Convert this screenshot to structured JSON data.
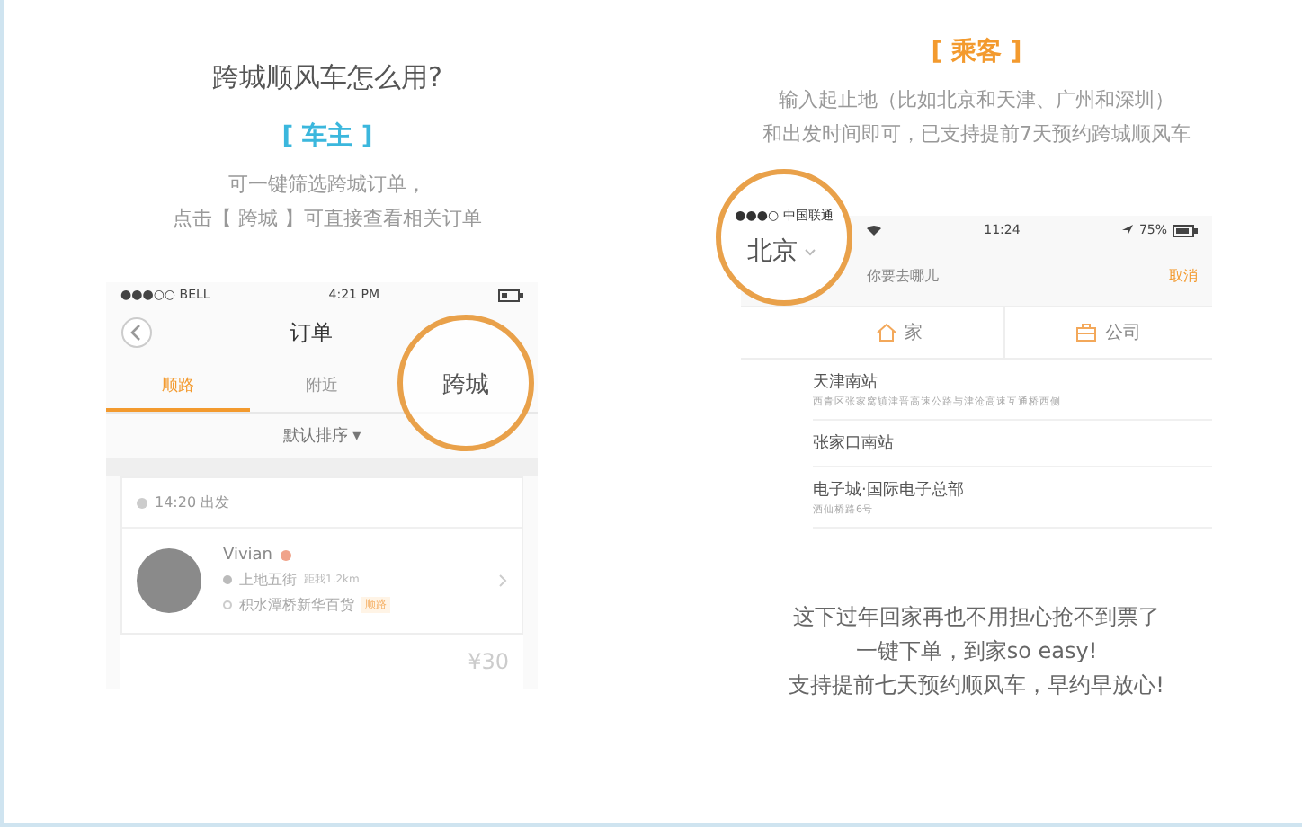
{
  "title": "跨城顺风车怎么用?",
  "driver": {
    "heading": "[ 车主 ]",
    "description": [
      "可一键筛选跨城订单，",
      "点击【 跨城 】可直接查看相关订单"
    ],
    "phone": {
      "carrier": "●●●○○ BELL",
      "time": "4:21 PM",
      "nav_title": "订单",
      "tabs": [
        {
          "label": "顺路",
          "selected": true
        },
        {
          "label": "附近",
          "selected": false
        },
        {
          "label": "跨城",
          "selected": false
        }
      ],
      "sort": "默认排序 ▾",
      "order": {
        "departure": "14:20 出发",
        "name": "Vivian",
        "from": "上地五街",
        "distance": "距我1.2km",
        "to": "积水潭桥新华百货",
        "tag": "顺路",
        "price": "¥30"
      }
    }
  },
  "passenger": {
    "heading": "[ 乘客 ]",
    "description": [
      "输入起止地（比如北京和天津、广州和深圳）",
      "和出发时间即可，已支持提前7天预约跨城顺风车"
    ],
    "phone": {
      "carrier": "●●●○ 中国联通",
      "time": "11:24",
      "battery": "75%",
      "city": "北京",
      "search_placeholder": "你要去哪儿",
      "cancel": "取消",
      "shortcuts": [
        {
          "kind": "home",
          "label": "家"
        },
        {
          "kind": "work",
          "label": "公司"
        }
      ],
      "places": [
        {
          "name": "天津南站",
          "address": "西青区张家窝镇津晋高速公路与津沧高速互通桥西侧"
        },
        {
          "name": "张家口南站"
        },
        {
          "name": "电子城·国际电子总部",
          "address": "酒仙桥路6号"
        }
      ]
    }
  },
  "footer": [
    "这下过年回家再也不用担心抢不到票了",
    "一键下单，到家so easy!",
    "支持提前七天预约顺风车，早约早放心!"
  ]
}
